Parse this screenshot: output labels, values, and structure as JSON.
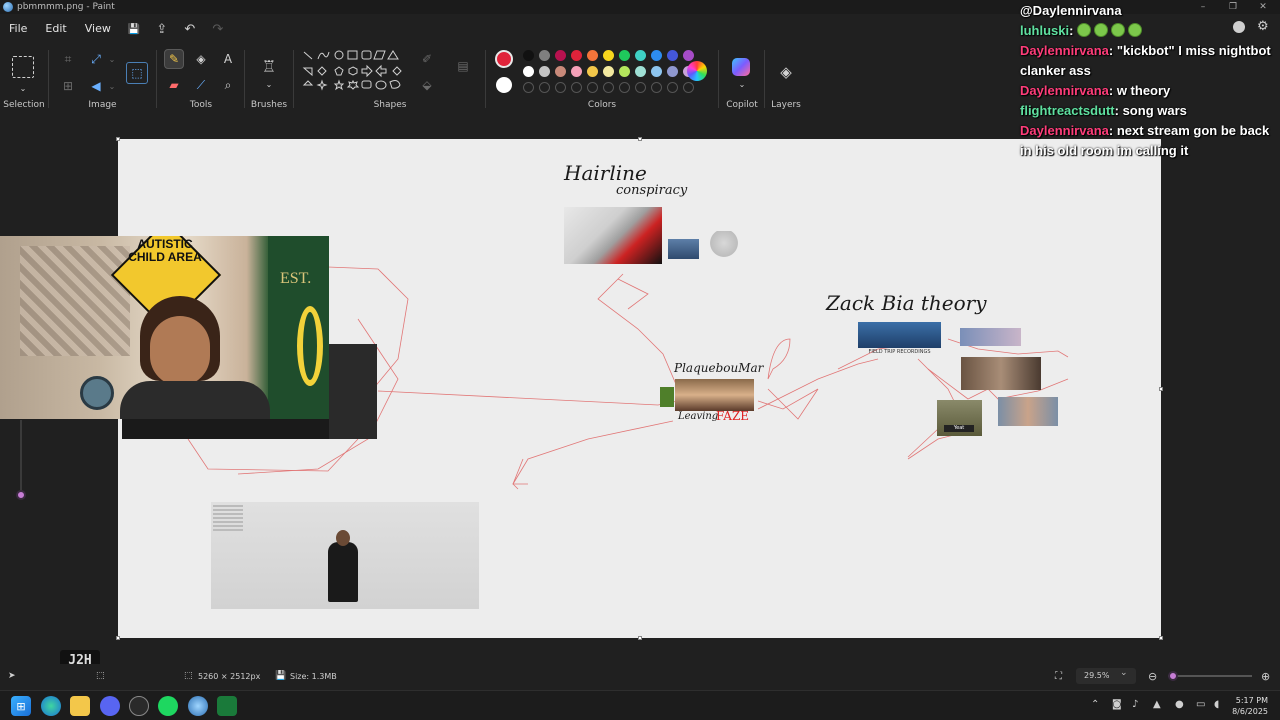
{
  "window": {
    "title": "pbmmmm.png - Paint",
    "controls": [
      "–",
      "❐",
      "✕"
    ]
  },
  "menu": {
    "items": [
      "File",
      "Edit",
      "View"
    ],
    "quick_actions": {
      "save": "💾",
      "share": "⇪",
      "undo": "↶",
      "redo": "↷"
    }
  },
  "ribbon": {
    "groups": {
      "selection": "Selection",
      "image": "Image",
      "tools": "Tools",
      "brushes": "Brushes",
      "shapes": "Shapes",
      "colors": "Colors",
      "copilot": "Copilot",
      "layers": "Layers"
    },
    "selected_color": "#e0233a",
    "secondary_color": "#ffffff",
    "palette_row1": [
      "#111111",
      "#7f7f7f",
      "#b8124f",
      "#e0233a",
      "#f3743a",
      "#f7d51d",
      "#1fc95c",
      "#3fd0c4",
      "#2d8cf0",
      "#4457d9",
      "#a64cc7"
    ],
    "palette_row2": [
      "#ffffff",
      "#c3c3c3",
      "#c98a7a",
      "#f4a0b8",
      "#f3c74a",
      "#f3e9a0",
      "#b5e65d",
      "#9fe0d5",
      "#8ec5ef",
      "#8f98cf",
      "#c9a2d9"
    ]
  },
  "canvas": {
    "labels": {
      "hairline_1": "Hairline",
      "hairline_2": "conspiracy",
      "zack_theory": "Zack Bia theory",
      "plaque": "PlaquebouMar",
      "leaving": "Leaving",
      "faze": "FAZE",
      "field_trip": "FIELD TRIP RECORDINGS",
      "yeat": "Yeat"
    }
  },
  "webcam": {
    "sign_text": "AUTISTIC CHILD AREA",
    "est": "EST."
  },
  "chat": {
    "header": "@Daylennirvana",
    "messages": [
      {
        "user": "luhluski",
        "user_color": "#5fe0a0",
        "text": ""
      },
      {
        "user": "Daylennirvana",
        "user_color": "#ff3d7a",
        "text": "\"kickbot\" I miss nightbot clanker ass"
      },
      {
        "user": "Daylennirvana",
        "user_color": "#ff3d7a",
        "text": "w theory"
      },
      {
        "user": "flightreactsdutt",
        "user_color": "#5fe0a0",
        "text": "song wars"
      },
      {
        "user": "Daylennirvana",
        "user_color": "#ff3d7a",
        "text": "next stream gon be back in his old room im calling it"
      }
    ]
  },
  "statusbar": {
    "dimensions": "5260 × 2512px",
    "size": "Size: 1.3MB",
    "zoom": "29.5%",
    "zoom_fraction": 0.06
  },
  "taskbar": {
    "time": "5:17 PM",
    "date": "8/6/2025"
  },
  "watermark": "J2H"
}
